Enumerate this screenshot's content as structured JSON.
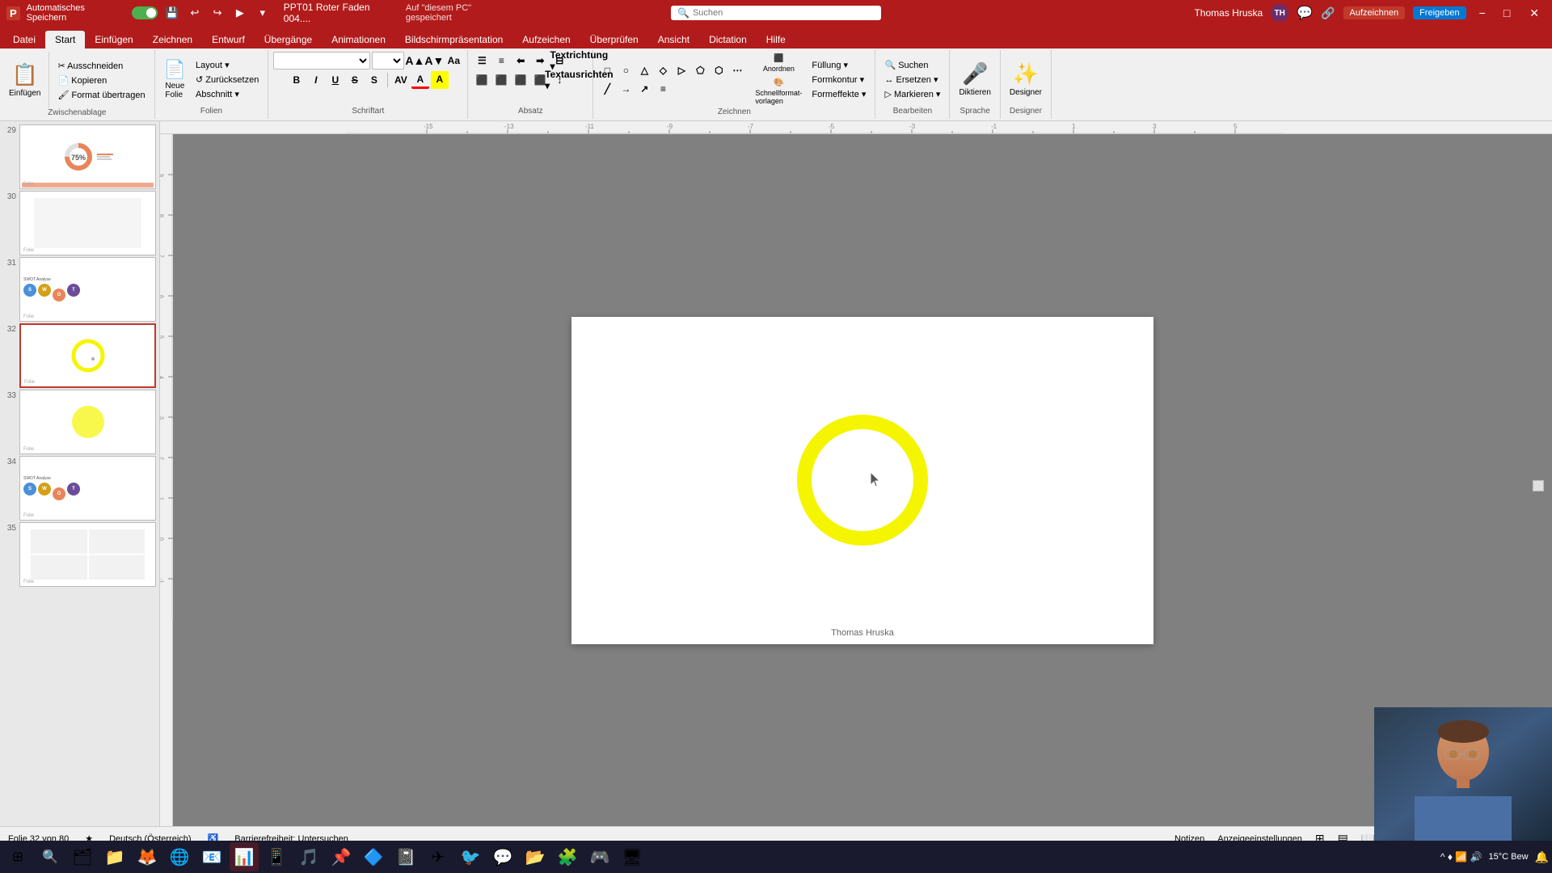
{
  "titleBar": {
    "autoSave": "Automatisches Speichern",
    "fileName": "PPT01 Roter Faden 004....",
    "savedLocation": "Auf \"diesem PC\" gespeichert",
    "searchPlaceholder": "Suchen",
    "userName": "Thomas Hruska",
    "userInitials": "TH",
    "minBtn": "−",
    "maxBtn": "□",
    "closeBtn": "✕"
  },
  "ribbonTabs": [
    {
      "label": "Datei",
      "active": false
    },
    {
      "label": "Start",
      "active": true
    },
    {
      "label": "Einfügen",
      "active": false
    },
    {
      "label": "Zeichnen",
      "active": false
    },
    {
      "label": "Entwurf",
      "active": false
    },
    {
      "label": "Übergänge",
      "active": false
    },
    {
      "label": "Animationen",
      "active": false
    },
    {
      "label": "Bildschirmpräsentation",
      "active": false
    },
    {
      "label": "Aufzeichen",
      "active": false
    },
    {
      "label": "Überprüfen",
      "active": false
    },
    {
      "label": "Ansicht",
      "active": false
    },
    {
      "label": "Dictation",
      "active": false
    },
    {
      "label": "Hilfe",
      "active": false
    }
  ],
  "ribbonGroups": {
    "zwischenablage": {
      "label": "Zwischenablage",
      "einfugen": "Einfügen",
      "ausschneiden": "Ausschneiden",
      "kopieren": "Kopieren",
      "formatUebertragen": "Format übertragen"
    },
    "folien": {
      "label": "Folien",
      "neueFollie": "Neue\nFolie",
      "layout": "Layout",
      "zuruecksetzen": "Zurücksetzen",
      "abschnitt": "Abschnitt"
    },
    "schriftart": {
      "label": "Schriftart",
      "bold": "F",
      "italic": "K",
      "underline": "U",
      "strikethrough": "S",
      "fontColor": "A",
      "increase": "A▲",
      "decrease": "A▼",
      "shadow": "S",
      "highlight": "A"
    },
    "absatz": {
      "label": "Absatz",
      "textrichtung": "Textrichtung",
      "textausrichten": "Text ausrichten",
      "konvertieren": "In SmartArt konvertieren"
    },
    "zeichnen": {
      "label": "Zeichnen",
      "anordnen": "Anordnen",
      "schnellformate": "Schnellformat-\nvorlagen"
    },
    "bearbeiten": {
      "label": "Bearbeiten",
      "suchen": "Suchen",
      "ersetzen": "Ersetzen",
      "markieren": "Markieren",
      "formeffekte": "Formeffekte"
    },
    "sprache": {
      "label": "Sprache",
      "diktieren": "Diktieren"
    },
    "designer": {
      "label": "Designer",
      "designer": "Designer"
    }
  },
  "slides": [
    {
      "num": "29",
      "type": "donut",
      "active": false
    },
    {
      "num": "30",
      "type": "blank",
      "active": false
    },
    {
      "num": "31",
      "type": "analysis",
      "active": false
    },
    {
      "num": "32",
      "type": "circle",
      "active": true
    },
    {
      "num": "33",
      "type": "yellow",
      "active": false
    },
    {
      "num": "34",
      "type": "analysis2",
      "active": false
    },
    {
      "num": "35",
      "type": "blank2",
      "active": false
    }
  ],
  "currentSlide": {
    "footerText": "Thomas Hruska"
  },
  "statusBar": {
    "slideInfo": "Folie 32 von 80",
    "language": "Deutsch (Österreich)",
    "accessibility": "Barrierefreiheit: Untersuchen",
    "notes": "Notizen",
    "displaySettings": "Anzeigeeinstellungen",
    "zoomIcon": "⊞"
  },
  "taskbar": {
    "systemIcon": "⊞",
    "icons": [
      "🗂",
      "📁",
      "🦊",
      "🌐",
      "📧",
      "📊",
      "📱",
      "🎵",
      "📌",
      "🔷",
      "📓",
      "✈",
      "🐦",
      "💬",
      "📂",
      "🧩",
      "🎮",
      "🖥"
    ],
    "systemTray": {
      "weather": "15°C  Bew",
      "time": ""
    }
  },
  "videoOverlay": {
    "visible": true
  }
}
